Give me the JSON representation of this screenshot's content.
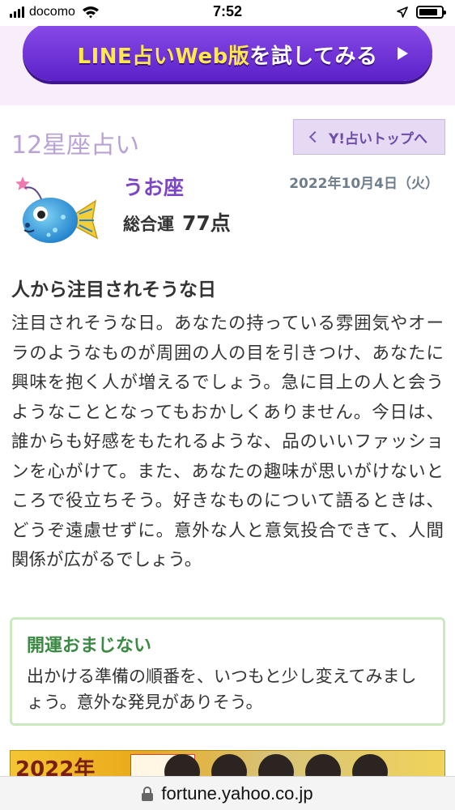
{
  "status_bar": {
    "carrier": "docomo",
    "time": "7:52",
    "icons": [
      "signal-icon",
      "wifi-icon",
      "location-icon",
      "battery-icon"
    ],
    "battery_level": 0.85
  },
  "banner": {
    "button_label_highlight": "LINE占いWeb版",
    "button_label_rest": "を試してみる",
    "arrow_icon": "play-arrow-icon"
  },
  "header": {
    "title": "12星座占い",
    "top_link_label": "Y!占いトップへ",
    "top_link_icon": "chevron-left-icon"
  },
  "sign": {
    "name": "うお座",
    "date": "2022年10月4日（火）",
    "overall_label": "総合運",
    "overall_score": "77点",
    "illustration": "pisces-fish-icon"
  },
  "reading": {
    "title": "人から注目されそうな日",
    "body": "注目されそうな日。あなたの持っている雰囲気やオーラのようなものが周囲の人の目を引きつけ、あなたに興味を抱く人が増えるでしょう。急に目上の人と会うようなこととなってもおかしくありません。今日は、誰からも好感をもたれるような、品のいいファッションを心がけて。また、あなたの趣味が思いがけないところで役立ちそう。好きなものについて語るときは、どうぞ遠慮せずに。意外な人と意気投合できて、人間関係が広がるでしょう。"
  },
  "charm": {
    "title": "開運おまじない",
    "text": "出かける準備の順番を、いつもと少し変えてみましょう。意外な発見がありそう。"
  },
  "ad": {
    "year_text": "2022年"
  },
  "url_bar": {
    "url": "fortune.yahoo.co.jp",
    "icon": "lock-icon"
  },
  "colors": {
    "accent_purple": "#7b45c5",
    "title_lavender": "#b8a2d6",
    "charm_green": "#3b8a44",
    "banner_bg": "#f7eefa"
  }
}
